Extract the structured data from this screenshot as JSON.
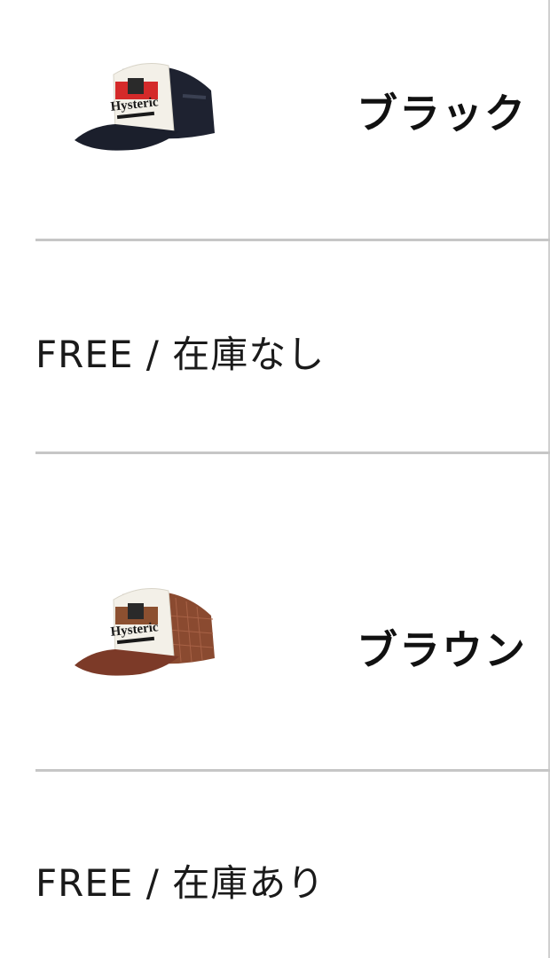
{
  "variants": [
    {
      "color_name": "ブラック",
      "image_icon": "trucker-cap-black-icon",
      "cap_colors": {
        "front": "#f3f0e8",
        "back": "#1e2230",
        "brim": "#1b1f2c",
        "patch": "#d42a2a"
      },
      "size_stock": "FREE / 在庫なし"
    },
    {
      "color_name": "ブラウン",
      "image_icon": "trucker-cap-brown-icon",
      "cap_colors": {
        "front": "#f3f0e8",
        "back": "#8a4a30",
        "brim": "#7c3a28",
        "patch": "#8c5030"
      },
      "size_stock": "FREE / 在庫あり"
    }
  ],
  "colors": {
    "divider": "#c6c6c6",
    "text": "#111111"
  }
}
